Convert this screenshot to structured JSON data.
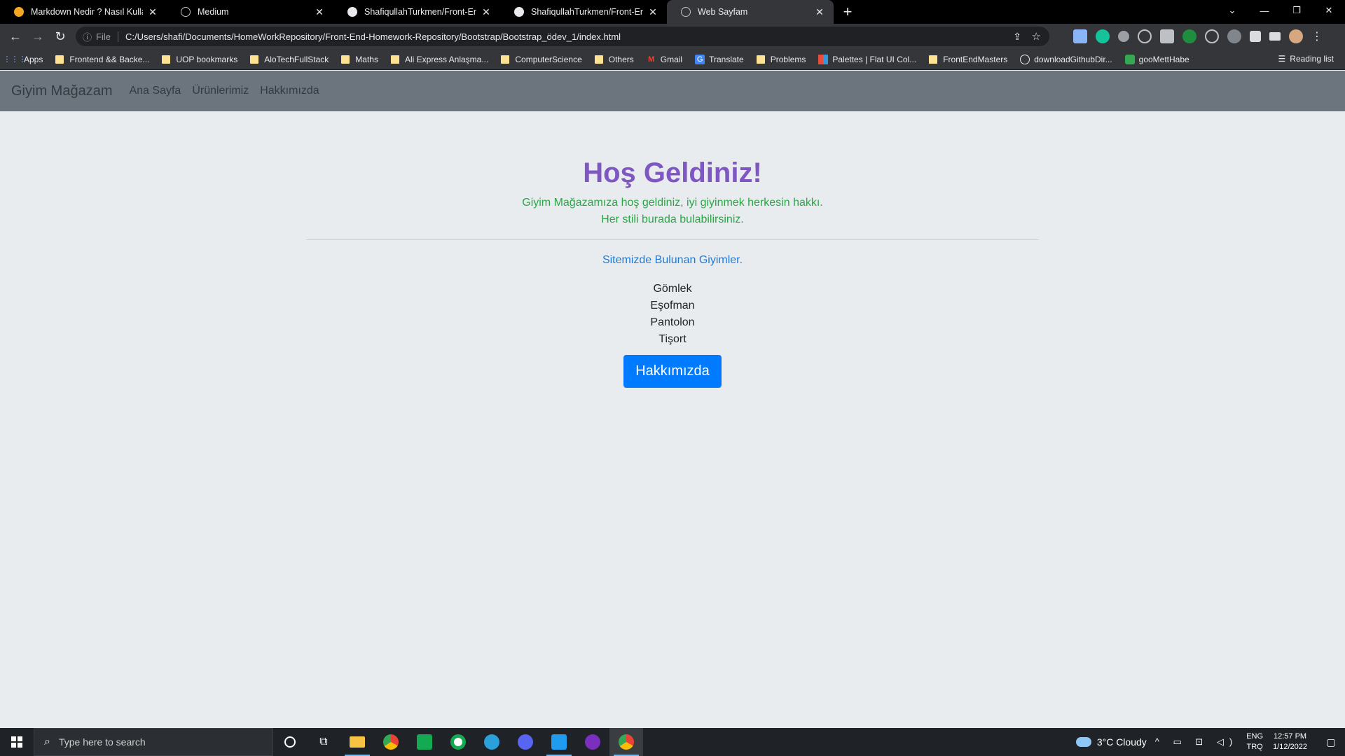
{
  "browser": {
    "tabs": [
      {
        "title": "Markdown Nedir ? Nasıl Kullanılır",
        "favicon": "medium-orange-icon"
      },
      {
        "title": "Medium",
        "favicon": "globe-icon"
      },
      {
        "title": "ShafiqullahTurkmen/Front-End-H",
        "favicon": "github-icon"
      },
      {
        "title": "ShafiqullahTurkmen/Front-End-H",
        "favicon": "github-icon"
      },
      {
        "title": "Web Sayfam",
        "favicon": "globe-icon"
      }
    ],
    "close_glyph": "✕",
    "new_tab_glyph": "+",
    "window_controls": {
      "min": "—",
      "restore": "❐",
      "close": "✕",
      "dropdown": "⌄"
    },
    "address": {
      "file_label": "File",
      "url": "C:/Users/shafi/Documents/HomeWorkRepository/Front-End-Homework-Repository/Bootstrap/Bootstrap_ödev_1/index.html"
    },
    "bookmarks": [
      {
        "label": "Apps",
        "icon": "apps-grid-icon"
      },
      {
        "label": "Frontend && Backe...",
        "icon": "folder-icon"
      },
      {
        "label": "UOP bookmarks",
        "icon": "folder-icon"
      },
      {
        "label": "AloTechFullStack",
        "icon": "folder-icon"
      },
      {
        "label": "Maths",
        "icon": "folder-icon"
      },
      {
        "label": "Ali Express Anlaşma...",
        "icon": "folder-icon"
      },
      {
        "label": "ComputerScience",
        "icon": "folder-icon"
      },
      {
        "label": "Others",
        "icon": "folder-icon"
      },
      {
        "label": "Gmail",
        "icon": "gmail-icon"
      },
      {
        "label": "Translate",
        "icon": "translate-icon"
      },
      {
        "label": "Problems",
        "icon": "folder-icon"
      },
      {
        "label": "Palettes | Flat UI Col...",
        "icon": "palette-icon"
      },
      {
        "label": "FrontEndMasters",
        "icon": "folder-icon"
      },
      {
        "label": "downloadGithubDir...",
        "icon": "globe-icon"
      },
      {
        "label": "gooMettHabe",
        "icon": "meet-icon"
      }
    ],
    "reading_list": "Reading list"
  },
  "site": {
    "brand": "Giyim Mağazam",
    "nav": [
      "Ana Sayfa",
      "Ürünlerimiz",
      "Hakkımızda"
    ],
    "heading": "Hoş Geldiniz!",
    "lead_line1": "Giyim Mağazamıza hoş geldiniz, iyi giyinmek herkesin hakkı.",
    "lead_line2": "Her stili burada bulabilirsiniz.",
    "subtitle": "Sitemizde Bulunan Giyimler.",
    "items": [
      "Gömlek",
      "Eşofman",
      "Pantolon",
      "Tişort"
    ],
    "button": "Hakkımızda"
  },
  "taskbar": {
    "search_placeholder": "Type here to search",
    "weather": "3°C  Cloudy",
    "lang_top": "ENG",
    "lang_bottom": "TRQ",
    "time": "12:57 PM",
    "date": "1/12/2022"
  },
  "colors": {
    "heading": "#7e57c2",
    "lead": "#28a745",
    "subtitle": "#1d7ad6",
    "button": "#007bff",
    "navbar": "#6c757d",
    "page_bg": "#e9ecef"
  }
}
